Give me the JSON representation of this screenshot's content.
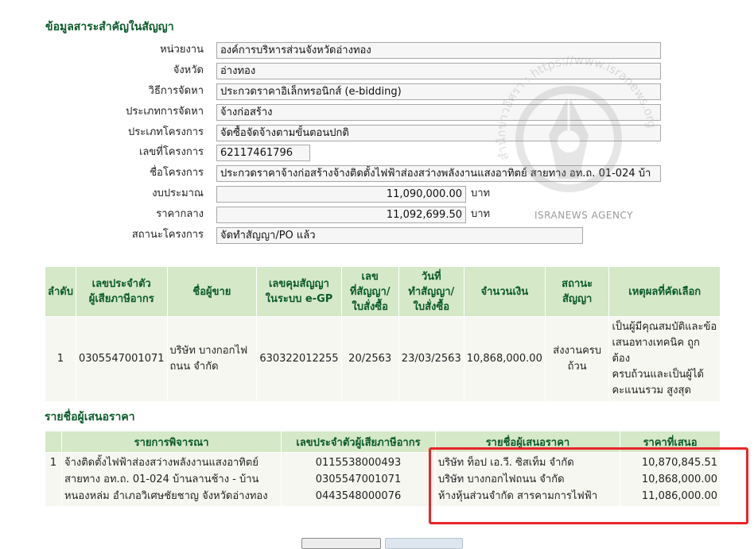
{
  "contract_info": {
    "title": "ข้อมูลสาระสำคัญในสัญญา",
    "fields": [
      {
        "label": "หน่วยงาน",
        "value": "องค์การบริหารส่วนจังหวัดอ่างทอง"
      },
      {
        "label": "จังหวัด",
        "value": "อ่างทอง"
      },
      {
        "label": "วิธีการจัดหา",
        "value": "ประกวดราคาอิเล็กทรอนิกส์ (e-bidding)"
      },
      {
        "label": "ประเภทการจัดหา",
        "value": "จ้างก่อสร้าง"
      },
      {
        "label": "ประเภทโครงการ",
        "value": "จัดซื้อจัดจ้างตามขั้นตอนปกติ"
      },
      {
        "label": "เลขที่โครงการ",
        "value": "62117461796"
      },
      {
        "label": "ชื่อโครงการ",
        "value": "ประกวดราคาจ้างก่อสร้างจ้างติดตั้งไฟฟ้าส่องสว่างพลังงานแสงอาทิตย์ สายทาง อท.ถ. 01-024 บ้า"
      },
      {
        "label": "งบประมาณ",
        "value": "11,090,000.00",
        "unit": "บาท"
      },
      {
        "label": "ราคากลาง",
        "value": "11,092,699.50",
        "unit": "บาท"
      },
      {
        "label": "สถานะโครงการ",
        "value": "จัดทำสัญญา/PO แล้ว"
      }
    ]
  },
  "award_table": {
    "headers": [
      "ลำดับ",
      "เลขประจำตัวผู้เสียภาษีอากร",
      "ชื่อผู้ขาย",
      "เลขคุมสัญญาในระบบ e-GP",
      "เลขที่สัญญา/ใบสั่งซื้อ",
      "วันที่ทำสัญญา/ใบสั่งซื้อ",
      "จำนวนเงิน",
      "สถานะสัญญา",
      "เหตุผลที่คัดเลือก"
    ],
    "header_lines": [
      [
        "ลำดับ"
      ],
      [
        "เลขประจำตัว",
        "ผู้เสียภาษีอากร"
      ],
      [
        "ชื่อผู้ขาย"
      ],
      [
        "เลขคุมสัญญา",
        "ในระบบ e-GP"
      ],
      [
        "เลข",
        "ที่สัญญา/",
        "ใบสั่งซื้อ"
      ],
      [
        "วันที่",
        "ทำสัญญา/",
        "ใบสั่งซื้อ"
      ],
      [
        "จำนวนเงิน"
      ],
      [
        "สถานะ",
        "สัญญา"
      ],
      [
        "เหตุผลที่คัดเลือก"
      ]
    ],
    "row": {
      "no": "1",
      "tax_id": "0305547001071",
      "vendor_lines": [
        "บริษัท บางกอกไฟ",
        "ถนน จำกัด"
      ],
      "egp_no": "630322012255",
      "contract_no": "20/2563",
      "date": "23/03/2563",
      "amount": "10,868,000.00",
      "status_lines": [
        "ส่งงานครบ",
        "ถ้วน"
      ],
      "reason_lines": [
        "เป็นผู้มีคุณสมบัติและข้อ",
        "เสนอทางเทคนิค ถูกต้อง",
        "ครบถ้วนและเป็นผู้ได้",
        "คะแนนรวม สูงสุด"
      ]
    }
  },
  "bidders": {
    "title": "รายชื่อผู้เสนอราคา",
    "headers": [
      "",
      "รายการพิจารณา",
      "เลขประจำตัวผู้เสียภาษีอากร",
      "รายชื่อผู้เสนอราคา",
      "ราคาที่เสนอ"
    ],
    "no": "1",
    "item_lines": [
      "จ้างติดตั้งไฟฟ้าส่องสว่างพลังงานแสงอาทิตย์",
      "สายทาง อท.ถ. 01-024 บ้านลานช้าง - บ้าน",
      "หนองหล่ม อำเภอวิเศษชัยชาญ จังหวัดอ่างทอง"
    ],
    "tax_ids": [
      "0115538000493",
      "0305547001071",
      "0443548000076"
    ],
    "names": [
      "บริษัท ท็อป เอ.วี. ซิสเท็ม จำกัด",
      "บริษัท บางกอกไฟถนน จำกัด",
      "ห้างหุ้นส่วนจำกัด สารคามการไฟฟ้า"
    ],
    "prices": [
      "10,870,845.51",
      "10,868,000.00",
      "11,086,000.00"
    ]
  },
  "watermark": {
    "arc_text": "สำนักข่าวอิศรา : https://www.isranews.org",
    "agency": "ISRANEWS AGENCY"
  },
  "colors": {
    "header_bg": "#d5e8c8",
    "header_text": "#0b5a2a",
    "highlight": "#e8262a"
  }
}
